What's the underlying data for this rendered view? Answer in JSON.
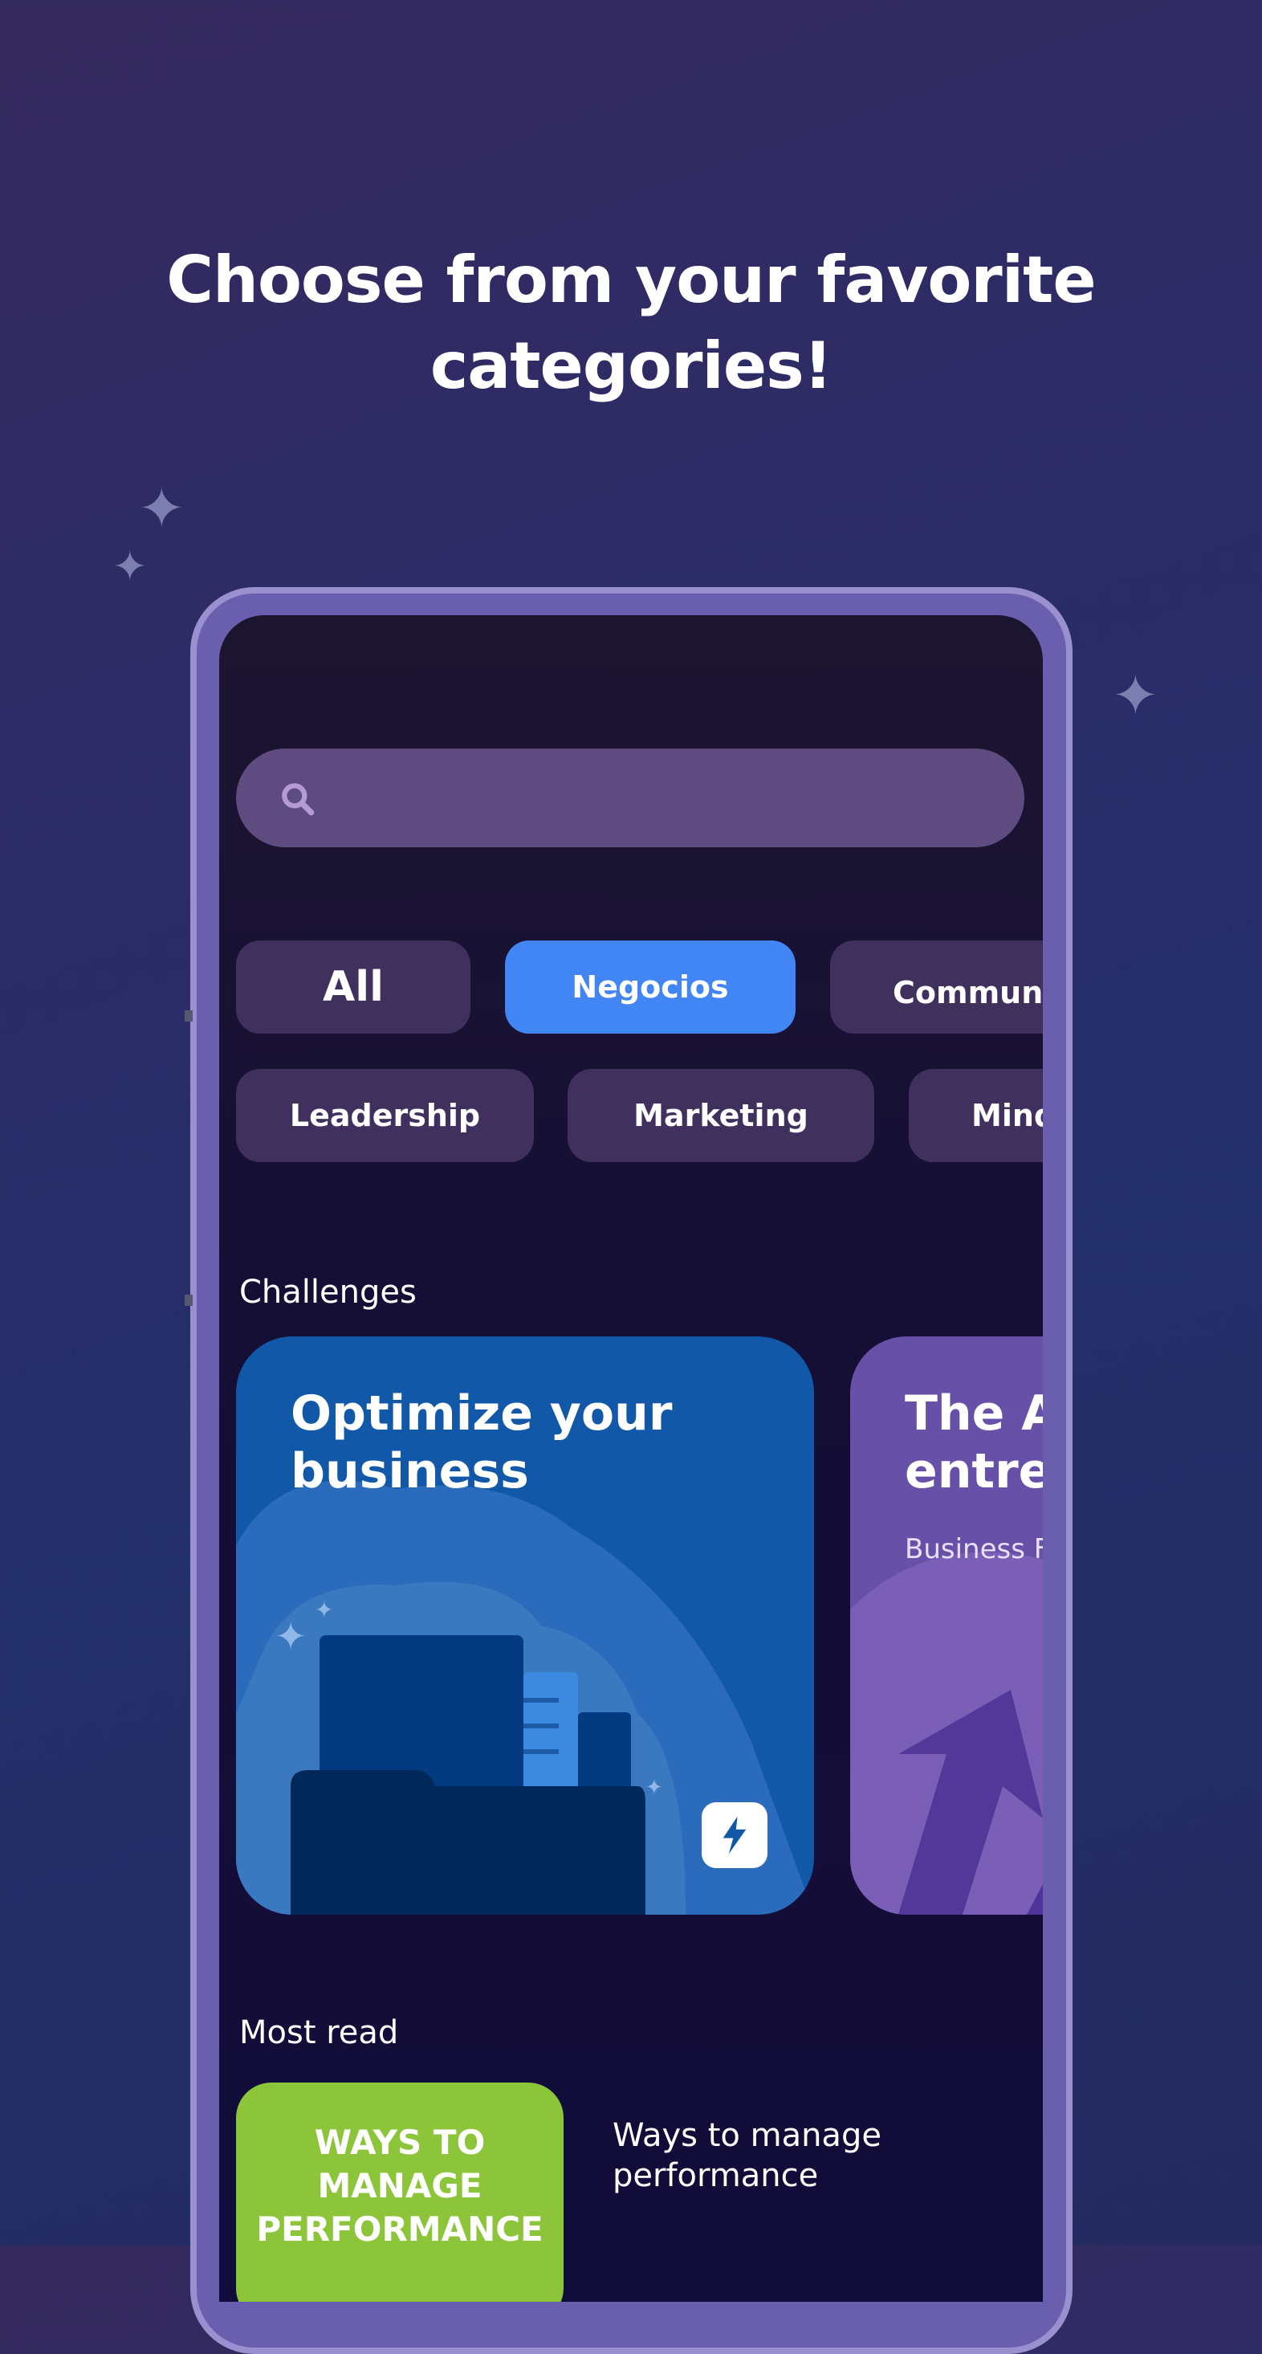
{
  "headline": {
    "line1": "Choose from your favorite",
    "line2": "categories!"
  },
  "search": {
    "placeholder": ""
  },
  "categories": [
    {
      "label": "All",
      "active": false
    },
    {
      "label": "Negocios",
      "active": true
    },
    {
      "label": "Commun",
      "active": false
    },
    {
      "label": "Leadership",
      "active": false
    },
    {
      "label": "Marketing",
      "active": false
    },
    {
      "label": "Mind",
      "active": false
    }
  ],
  "challenges": {
    "title": "Challenges",
    "cards": [
      {
        "title1": "Optimize your",
        "title2": "business",
        "subtitle": ""
      },
      {
        "title1": "The A",
        "title2": "entre",
        "subtitle": "Business F"
      }
    ]
  },
  "most_read": {
    "title": "Most read",
    "items": [
      {
        "cover_text": [
          "WAYS TO",
          "MANAGE",
          "PERFORMANCE"
        ],
        "title1": "Ways to manage",
        "title2": "performance"
      }
    ]
  },
  "colors": {
    "accent": "#4285f4",
    "chip": "#3f305e",
    "search": "#5e4b80",
    "card_blue": "#1158a8",
    "card_purple": "#6750a8",
    "cover_green": "#8cc43a"
  }
}
